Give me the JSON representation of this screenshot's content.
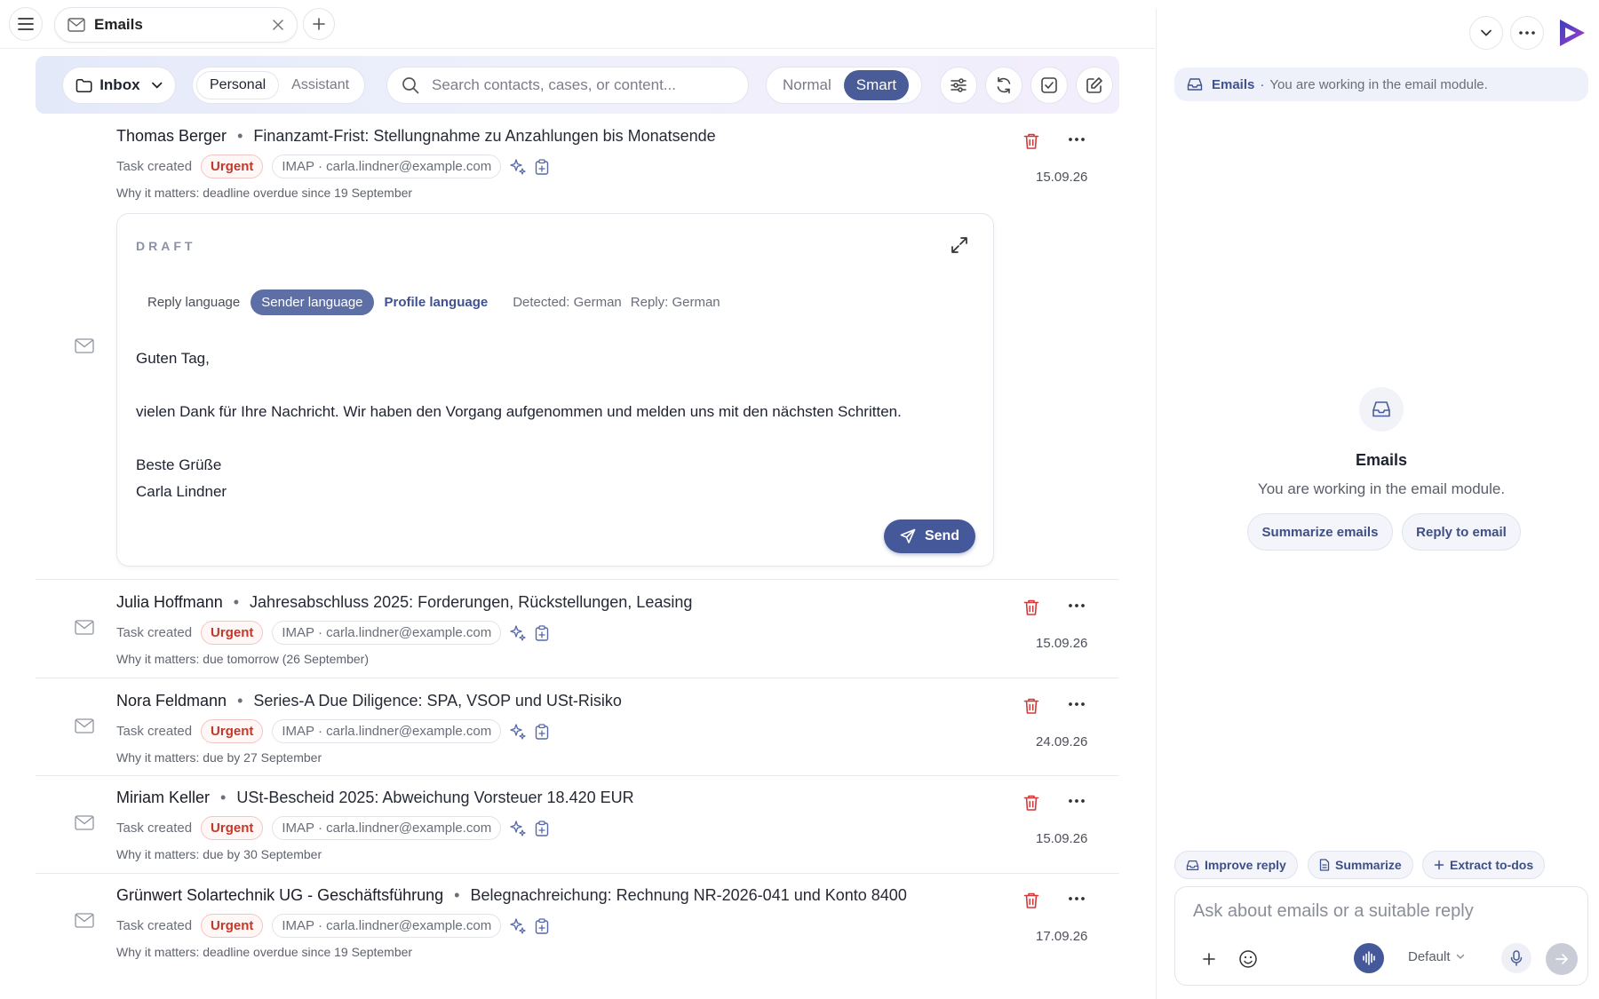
{
  "tab": {
    "label": "Emails"
  },
  "toolbar": {
    "folder": "Inbox",
    "views": [
      "Personal",
      "Assistant"
    ],
    "search_placeholder": "Search contacts, cases, or content...",
    "modes": [
      "Normal",
      "Smart"
    ]
  },
  "emails": [
    {
      "sender": "Thomas Berger",
      "subject": "Finanzamt-Frist: Stellungnahme zu Anzahlungen bis Monatsende",
      "status": "Task created",
      "priority": "Urgent",
      "account": "IMAP · carla.lindner@example.com",
      "why": "Why it matters: deadline overdue since 19 September",
      "date": "15.09.26"
    },
    {
      "sender": "Julia Hoffmann",
      "subject": "Jahresabschluss 2025: Forderungen, Rückstellungen, Leasing",
      "status": "Task created",
      "priority": "Urgent",
      "account": "IMAP · carla.lindner@example.com",
      "why": "Why it matters: due tomorrow (26 September)",
      "date": "15.09.26"
    },
    {
      "sender": "Nora Feldmann",
      "subject": "Series-A Due Diligence: SPA, VSOP und USt-Risiko",
      "status": "Task created",
      "priority": "Urgent",
      "account": "IMAP · carla.lindner@example.com",
      "why": "Why it matters: due by 27 September",
      "date": "24.09.26"
    },
    {
      "sender": "Miriam Keller",
      "subject": "USt-Bescheid 2025: Abweichung Vorsteuer 18.420 EUR",
      "status": "Task created",
      "priority": "Urgent",
      "account": "IMAP · carla.lindner@example.com",
      "why": "Why it matters: due by 30 September",
      "date": "15.09.26"
    },
    {
      "sender": "Grünwert Solartechnik UG - Geschäftsführung",
      "subject": "Belegnachreichung: Rechnung NR-2026-041 und Konto 8400",
      "status": "Task created",
      "priority": "Urgent",
      "account": "IMAP · carla.lindner@example.com",
      "why": "Why it matters: deadline overdue since 19 September",
      "date": "17.09.26"
    }
  ],
  "draft": {
    "label": "DRAFT",
    "reply_language_label": "Reply language",
    "sender_language": "Sender language",
    "profile_language": "Profile language",
    "detected": "Detected: German",
    "reply": "Reply: German",
    "greeting": "Guten Tag,",
    "body": "vielen Dank für Ihre Nachricht. Wir haben den Vorgang aufgenommen und melden uns mit den nächsten Schritten.",
    "closing": "Beste Grüße",
    "signature": "Carla Lindner",
    "send_label": "Send"
  },
  "assistant": {
    "banner_module": "Emails",
    "banner_dot": "·",
    "banner_text": "You are working in the email module.",
    "title": "Emails",
    "subtitle": "You are working in the email module.",
    "suggestions": [
      "Summarize emails",
      "Reply to email"
    ],
    "quick_actions": [
      "Improve reply",
      "Summarize",
      "Extract to-dos"
    ],
    "input_placeholder": "Ask about emails or a suitable reply",
    "model": "Default"
  },
  "colors": {
    "accent": "#45599a",
    "urgent": "#c0392b",
    "trash": "#d23a3a"
  }
}
